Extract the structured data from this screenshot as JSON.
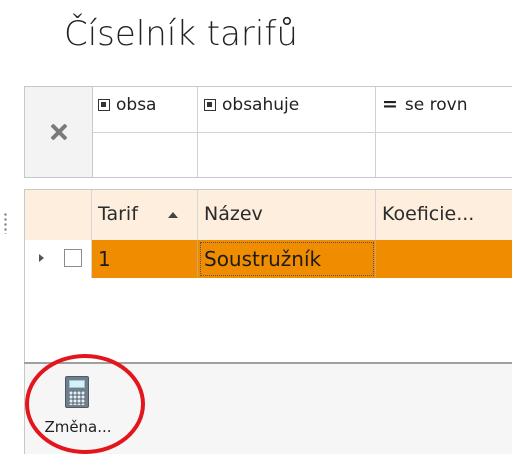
{
  "page": {
    "title": "Číselník tarifů"
  },
  "filter": {
    "clear_icon": "close-icon",
    "operators": [
      {
        "icon": "square-op-icon",
        "label": "obsa"
      },
      {
        "icon": "square-op-icon",
        "label": "obsahuje"
      },
      {
        "icon": "equals-op-icon",
        "symbol": "=",
        "label": "se rovn"
      }
    ],
    "values": [
      "",
      "",
      ""
    ]
  },
  "grid": {
    "columns": [
      {
        "label": "Tarif",
        "sort": "ascending"
      },
      {
        "label": "Název"
      },
      {
        "label": "Koeficie..."
      }
    ],
    "rows": [
      {
        "cells": [
          "1",
          "Soustružník",
          ""
        ],
        "selected": true,
        "checked": false
      }
    ],
    "selected_row_color": "#f08c00",
    "header_color": "#fdeedd"
  },
  "toolbar": {
    "buttons": [
      {
        "icon": "calculator-icon",
        "label": "Změna..."
      }
    ]
  },
  "annotation": {
    "highlight_color": "#e2161d",
    "shape": "ellipse"
  }
}
